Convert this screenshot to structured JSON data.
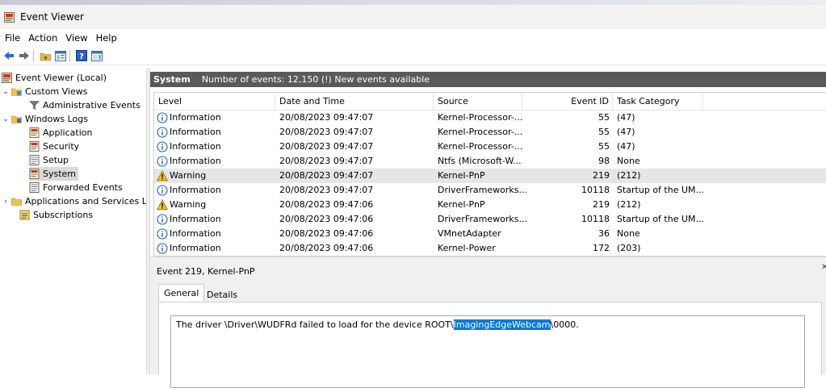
{
  "window": {
    "title": "Event Viewer"
  },
  "menu": [
    "File",
    "Action",
    "View",
    "Help"
  ],
  "toolbar": {
    "icons": [
      "back-arrow-icon",
      "forward-arrow-icon",
      "folder-up-icon",
      "show-hide-tree-icon",
      "help-icon",
      "properties-icon"
    ]
  },
  "tree": {
    "root": "Event Viewer (Local)",
    "custom_views": "Custom Views",
    "administrative_events": "Administrative Events",
    "windows_logs": "Windows Logs",
    "application": "Application",
    "security": "Security",
    "setup": "Setup",
    "system": "System",
    "forwarded_events": "Forwarded Events",
    "apps_services": "Applications and Services Logs",
    "subscriptions": "Subscriptions"
  },
  "pane": {
    "name": "System",
    "count_text": "Number of events: 12,150 (!) New events available"
  },
  "columns": {
    "level": "Level",
    "datetime": "Date and Time",
    "source": "Source",
    "eventid": "Event ID",
    "task": "Task Category"
  },
  "events": [
    {
      "level": "Information",
      "datetime": "20/08/2023 09:47:07",
      "source": "Kernel-Processor-...",
      "eventid": "55",
      "task": "(47)"
    },
    {
      "level": "Information",
      "datetime": "20/08/2023 09:47:07",
      "source": "Kernel-Processor-...",
      "eventid": "55",
      "task": "(47)"
    },
    {
      "level": "Information",
      "datetime": "20/08/2023 09:47:07",
      "source": "Kernel-Processor-...",
      "eventid": "55",
      "task": "(47)"
    },
    {
      "level": "Information",
      "datetime": "20/08/2023 09:47:07",
      "source": "Ntfs (Microsoft-W...",
      "eventid": "98",
      "task": "None"
    },
    {
      "level": "Warning",
      "datetime": "20/08/2023 09:47:07",
      "source": "Kernel-PnP",
      "eventid": "219",
      "task": "(212)"
    },
    {
      "level": "Information",
      "datetime": "20/08/2023 09:47:07",
      "source": "DriverFrameworks...",
      "eventid": "10118",
      "task": "Startup of the UM..."
    },
    {
      "level": "Warning",
      "datetime": "20/08/2023 09:47:06",
      "source": "Kernel-PnP",
      "eventid": "219",
      "task": "(212)"
    },
    {
      "level": "Information",
      "datetime": "20/08/2023 09:47:06",
      "source": "DriverFrameworks...",
      "eventid": "10118",
      "task": "Startup of the UM..."
    },
    {
      "level": "Information",
      "datetime": "20/08/2023 09:47:06",
      "source": "VMnetAdapter",
      "eventid": "36",
      "task": "None"
    },
    {
      "level": "Information",
      "datetime": "20/08/2023 09:47:06",
      "source": "Kernel-Power",
      "eventid": "172",
      "task": "(203)"
    }
  ],
  "detail": {
    "title": "Event 219, Kernel-PnP",
    "tab_general": "General",
    "tab_details": "Details",
    "message_pre": "The driver \\Driver\\WUDFRd failed to load for the device ROOT\\",
    "message_highlight": "ImagingEdgeWebcam",
    "message_post": "\\0000."
  },
  "colors": {
    "header_bg": "#5a5a5a",
    "selection": "#0078d7",
    "row_selected": "#e6e6e6"
  }
}
